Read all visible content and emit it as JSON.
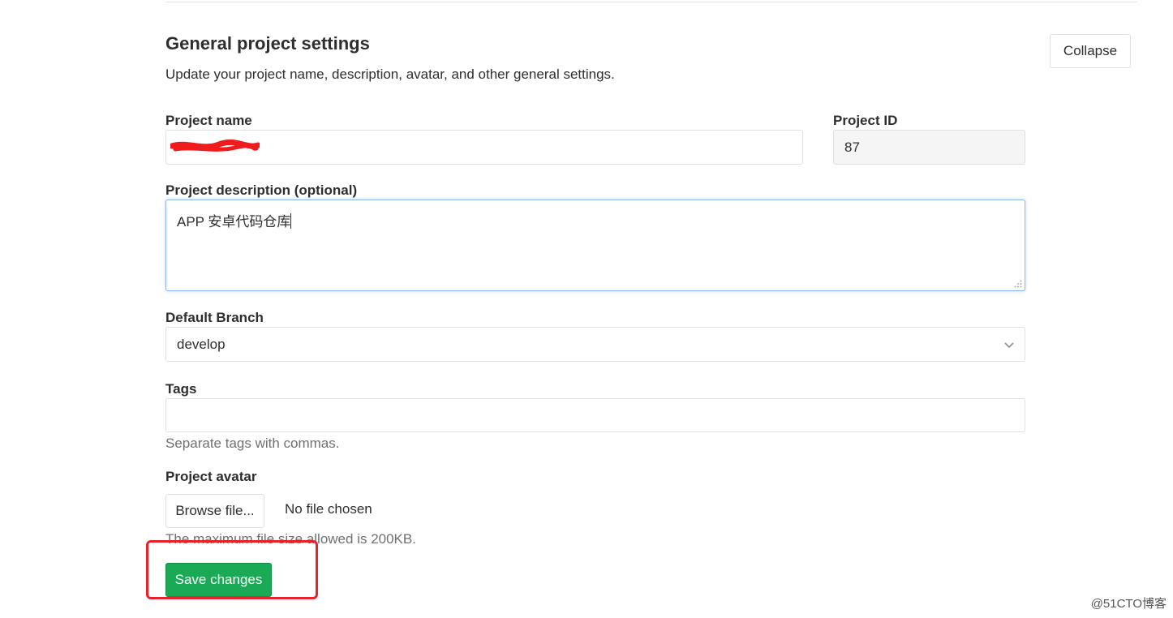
{
  "section": {
    "title": "General project settings",
    "description": "Update your project name, description, avatar, and other general settings.",
    "collapse_label": "Collapse"
  },
  "project_name": {
    "label": "Project name",
    "value_redacted": true
  },
  "project_id": {
    "label": "Project ID",
    "value": "87"
  },
  "project_description": {
    "label": "Project description (optional)",
    "value": "APP 安卓代码仓库"
  },
  "default_branch": {
    "label": "Default Branch",
    "value": "develop"
  },
  "tags": {
    "label": "Tags",
    "value": "",
    "help": "Separate tags with commas."
  },
  "avatar": {
    "label": "Project avatar",
    "browse_label": "Browse file...",
    "status": "No file chosen",
    "help": "The maximum file size allowed is 200KB."
  },
  "save_label": "Save changes",
  "watermark": "@51CTO博客",
  "colors": {
    "save_button": "#1aaa55",
    "highlight": "#e8202a",
    "focus_border": "#8fb8e8"
  }
}
